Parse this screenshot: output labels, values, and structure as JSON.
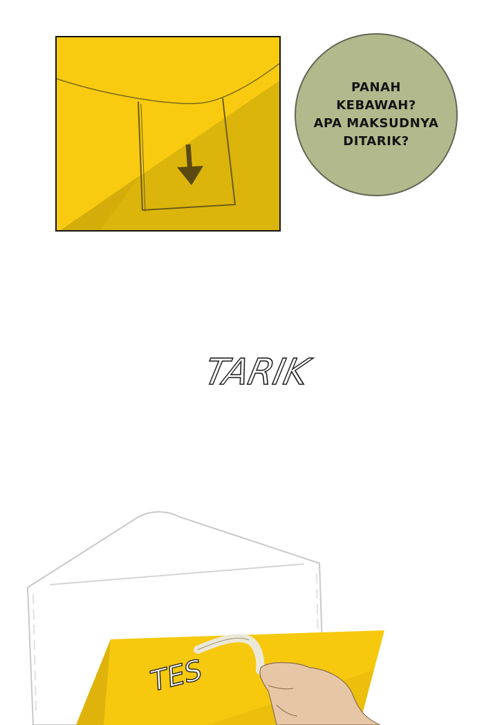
{
  "bubble": {
    "lines": [
      "PANAH",
      "KEBAWAH?",
      "APA MAKSUDNYA",
      "DITARIK?"
    ]
  },
  "sfx": {
    "tarik": "TARIK",
    "tes": "TES"
  },
  "colors": {
    "envelope_yellow": "#f6c90e",
    "envelope_shade": "#d8b10a",
    "bubble_fill": "#b2b98c",
    "skin": "#e7c6a6"
  }
}
